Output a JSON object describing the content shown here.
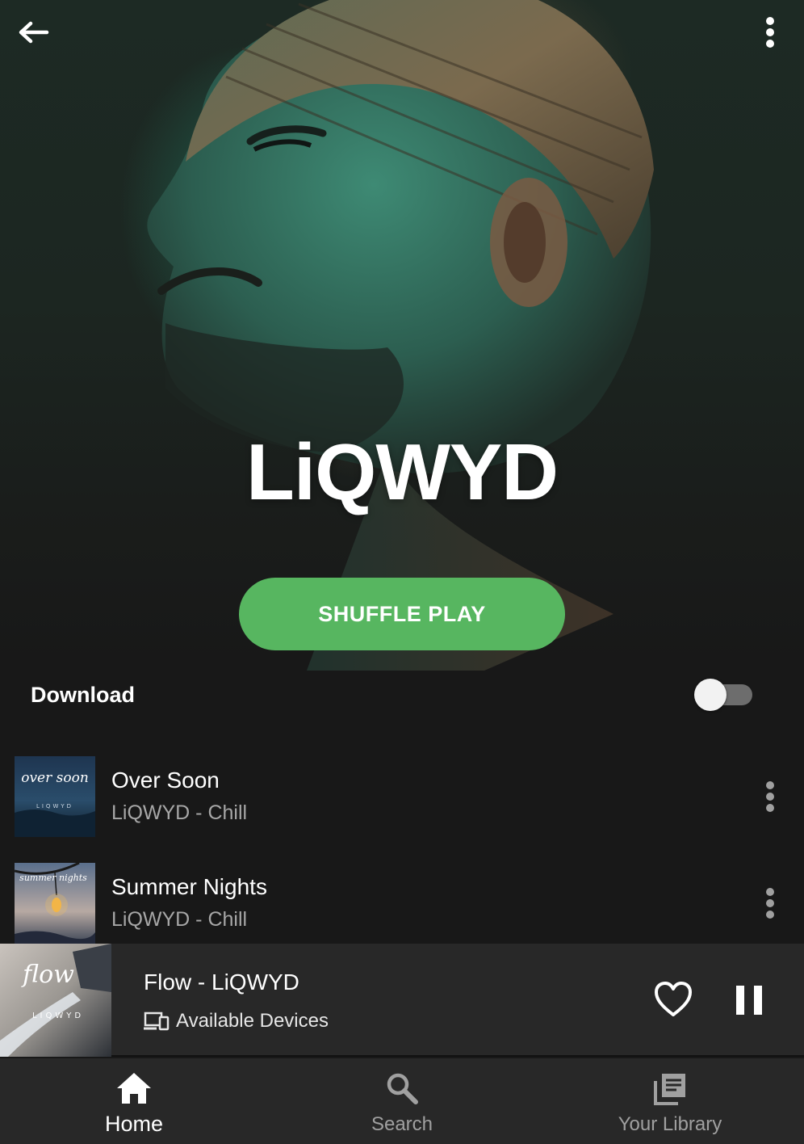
{
  "artist": {
    "name": "LiQWYD",
    "shuffle_label": "SHUFFLE PLAY"
  },
  "download": {
    "label": "Download",
    "enabled": false
  },
  "tracks": [
    {
      "title": "Over Soon",
      "subtitle": "LiQWYD - Chill",
      "art_text": "over soon",
      "art_sub": "LIQWYD"
    },
    {
      "title": "Summer Nights",
      "subtitle": "LiQWYD - Chill",
      "art_text": "summer nights"
    }
  ],
  "now_playing": {
    "title": "Flow - LiQWYD",
    "devices_label": "Available Devices",
    "art_text": "flow",
    "art_sub": "LIQWYD",
    "liked": false,
    "state": "playing"
  },
  "nav": {
    "items": [
      {
        "label": "Home",
        "icon": "home-icon",
        "active": true
      },
      {
        "label": "Search",
        "icon": "search-icon",
        "active": false
      },
      {
        "label": "Your Library",
        "icon": "library-icon",
        "active": false
      }
    ]
  },
  "colors": {
    "accent": "#57b660",
    "background": "#181818",
    "player_bar": "#282828",
    "secondary_text": "#a7a7a7"
  }
}
